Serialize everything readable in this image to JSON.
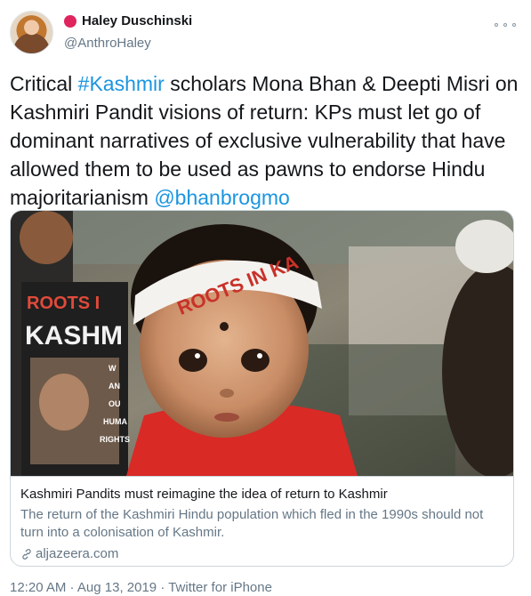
{
  "user": {
    "display_name": "Haley Duschinski",
    "handle": "@AnthroHaley",
    "status_dot_color": "#e0245e"
  },
  "tweet": {
    "text_prefix": "Critical ",
    "hashtag": "#Kashmir",
    "text_body": " scholars Mona Bhan & Deepti Misri on Kashmiri Pandit visions of return: KPs must let go of dominant narratives of exclusive vulnerability that have allowed them to be used as pawns to endorse Hindu majoritarianism ",
    "mention": "@bhanbrogmo",
    "link_color": "#1b95e0"
  },
  "card": {
    "image_signs": {
      "headband": "ROOTS IN KA",
      "left_sign_top": "ROOTS I",
      "left_sign_big": "KASHM",
      "poster_words": [
        "W",
        "AN",
        "OU",
        "HUMA",
        "RIGHTS"
      ]
    },
    "title": "Kashmiri Pandits must reimagine the idea of return to Kashmir",
    "description": "The return of the Kashmiri Hindu population which fled in the 1990s should not turn into a colonisation of Kashmir.",
    "domain": "aljazeera.com"
  },
  "meta": {
    "time": "12:20 AM",
    "separator": " · ",
    "date": "Aug 13, 2019",
    "source": "Twitter for iPhone"
  }
}
